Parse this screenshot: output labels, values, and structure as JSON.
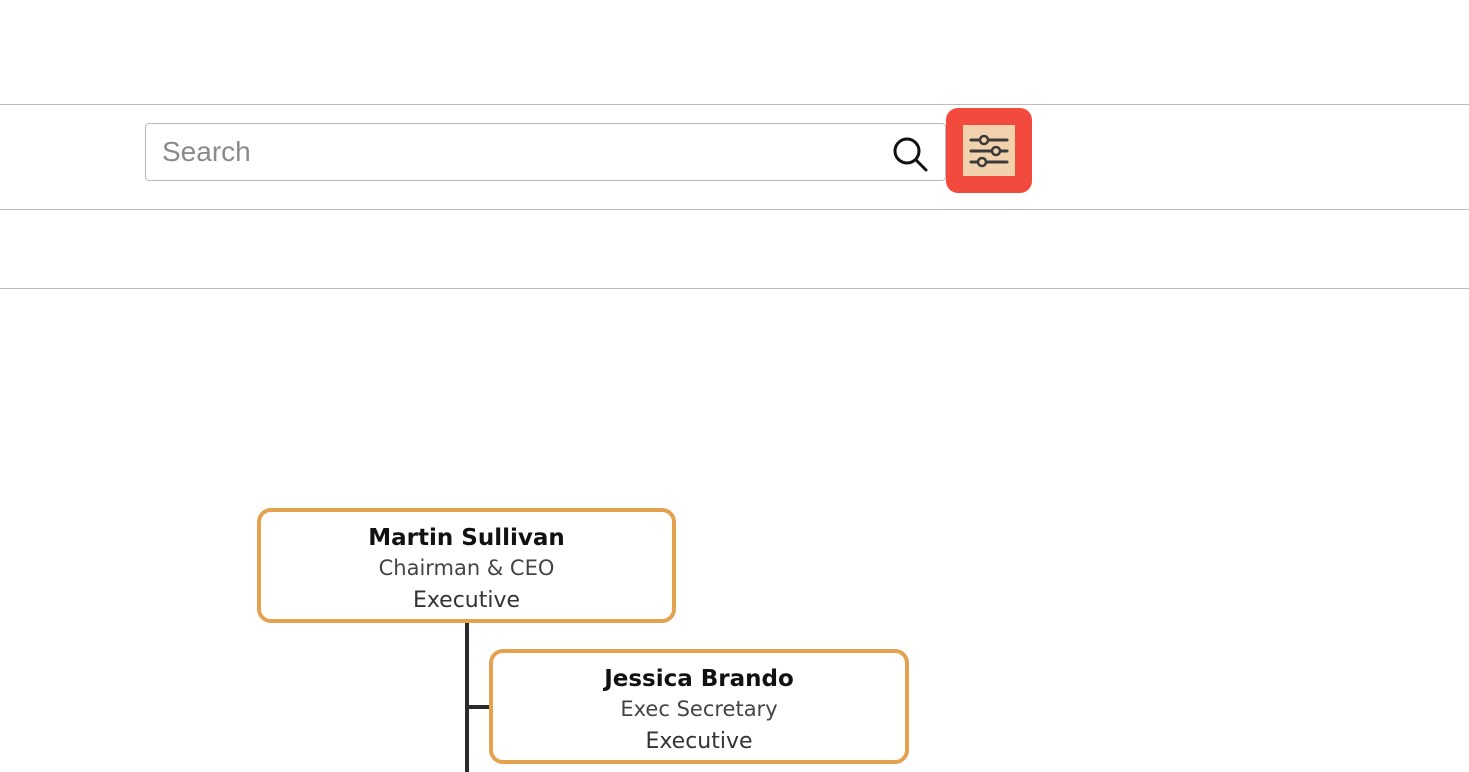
{
  "search": {
    "placeholder": "Search",
    "value": ""
  },
  "icons": {
    "search": "search-icon",
    "filter": "sliders-icon"
  },
  "colors": {
    "filter_button_bg": "#f24a3c",
    "filter_button_inner": "#f1d2ad",
    "node_border": "#e4a24f",
    "connector": "#2b2b2b"
  },
  "org_chart": {
    "nodes": [
      {
        "name": "Martin Sullivan",
        "title": "Chairman & CEO",
        "department": "Executive"
      },
      {
        "name": "Jessica Brando",
        "title": "Exec Secretary",
        "department": "Executive"
      }
    ]
  }
}
